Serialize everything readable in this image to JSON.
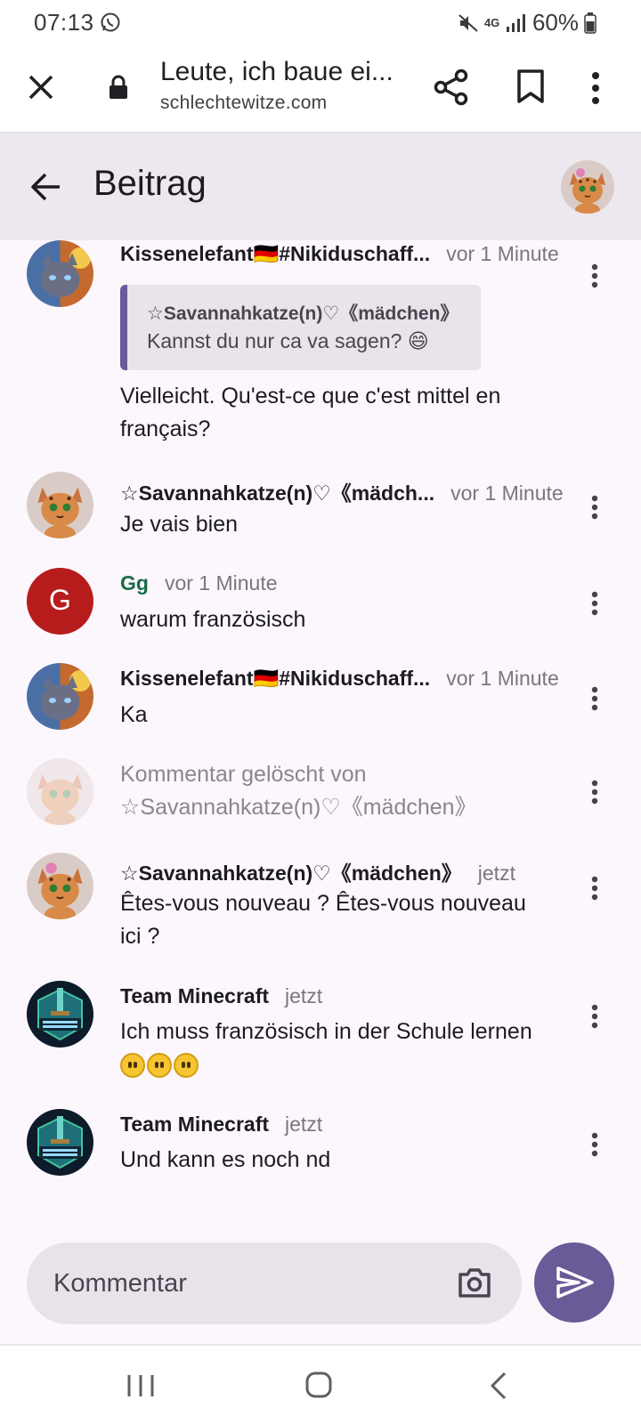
{
  "status_bar": {
    "time": "07:13",
    "battery": "60%",
    "network": "4G"
  },
  "browser": {
    "title": "Leute, ich baue ei...",
    "url": "schlechtewitze.com"
  },
  "header": {
    "title": "Beitrag"
  },
  "comments": [
    {
      "author": "Kissenelefant🇩🇪#Nikiduschaff...",
      "time": "vor 1 Minute",
      "quote_author": "☆Savannahkatze(n)♡《mädchen》",
      "quote_text": "Kannst du nur ca va sagen? 😄",
      "text": "Vielleicht. Qu'est-ce que c'est mittel en français?"
    },
    {
      "author": "☆Savannahkatze(n)♡《mädch...",
      "time": "vor 1 Minute",
      "text": "Je vais bien"
    },
    {
      "author": "Gg",
      "avatar_letter": "G",
      "time": "vor 1 Minute",
      "text": "warum französisch"
    },
    {
      "author": "Kissenelefant🇩🇪#Nikiduschaff...",
      "time": "vor 1 Minute",
      "text": "Ka"
    },
    {
      "deleted_text": "Kommentar gelöscht von ☆Savannahkatze(n)♡《mädchen》"
    },
    {
      "author": "☆Savannahkatze(n)♡《mädchen》",
      "time": "jetzt",
      "text": "Êtes-vous nouveau ? Êtes-vous nouveau ici ?"
    },
    {
      "author": "Team Minecraft",
      "time": "jetzt",
      "text": "Ich muss französisch in der Schule lernen"
    },
    {
      "author": "Team Minecraft",
      "time": "jetzt",
      "text": "Und kann es noch nd"
    }
  ],
  "composer": {
    "placeholder": "Kommentar"
  },
  "colors": {
    "accent": "#6a5a97",
    "header_bg": "#ede8ef",
    "page_bg": "#fcf7fd",
    "avatar_g": "#b71c1c",
    "author_green": "#1b6b47"
  },
  "icons": {
    "status": [
      "whatsapp-icon",
      "mute-icon",
      "signal-icon",
      "battery-icon"
    ],
    "browser": [
      "close-icon",
      "lock-icon",
      "share-icon",
      "bookmark-icon",
      "more-vert-icon"
    ],
    "app": [
      "back-arrow-icon",
      "camera-icon",
      "send-icon"
    ],
    "nav": [
      "recent-apps-icon",
      "home-icon",
      "nav-back-icon"
    ]
  }
}
